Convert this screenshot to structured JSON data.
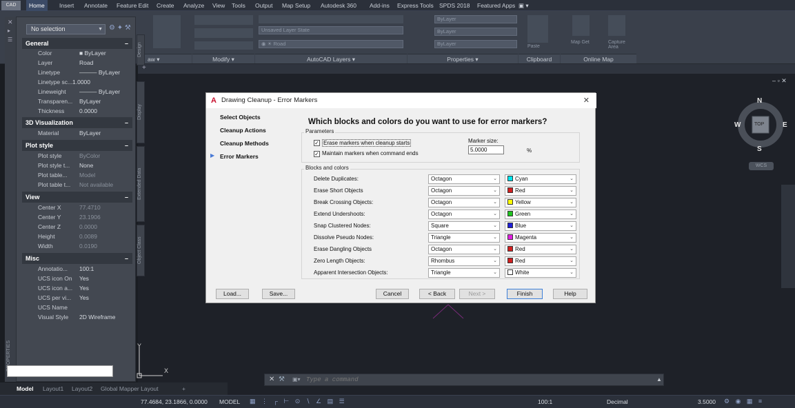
{
  "ribbon": {
    "app_button": "CAD",
    "tabs": [
      "Home",
      "Insert",
      "Annotate",
      "Feature Edit",
      "Create",
      "Analyze",
      "View",
      "Tools",
      "Output",
      "Map Setup",
      "Autodesk 360",
      "Add-ins",
      "Express Tools",
      "SPDS 2018",
      "Featured Apps"
    ],
    "active_tab": "Home",
    "panels": {
      "draw": "aw",
      "modify": "Modify",
      "layers": "AutoCAD Layers",
      "properties": "Properties",
      "clipboard": "Clipboard",
      "online_map": "Online Map"
    },
    "layer_state": "Unsaved Layer State",
    "layer_current": "Road",
    "bylayer_1": "ByLayer",
    "bylayer_2": "ByLayer",
    "bylayer_3": "ByLayer",
    "paste": "Paste",
    "map_get": "Map Get",
    "capture_area": "Capture Area"
  },
  "properties_palette": {
    "selection": "No selection",
    "side_title": "PROPERTIES",
    "vertical_tabs": [
      "Design",
      "Display",
      "Extended Data",
      "Object Class"
    ],
    "categories": {
      "general": "General",
      "viz3d": "3D Visualization",
      "plot": "Plot style",
      "view": "View",
      "misc": "Misc"
    },
    "general_rows": [
      {
        "k": "Color",
        "v": "■ ByLayer"
      },
      {
        "k": "Layer",
        "v": "Road"
      },
      {
        "k": "Linetype",
        "v": "——— ByLayer"
      },
      {
        "k": "Linetype sc...",
        "v": "1.0000"
      },
      {
        "k": "Lineweight",
        "v": "——— ByLayer"
      },
      {
        "k": "Transparen...",
        "v": "ByLayer"
      },
      {
        "k": "Thickness",
        "v": "0.0000"
      }
    ],
    "viz3d_rows": [
      {
        "k": "Material",
        "v": "ByLayer"
      }
    ],
    "plot_rows": [
      {
        "k": "Plot style",
        "v": "ByColor"
      },
      {
        "k": "Plot style t...",
        "v": "None"
      },
      {
        "k": "Plot table...",
        "v": "Model"
      },
      {
        "k": "Plot table t...",
        "v": "Not available"
      }
    ],
    "view_rows": [
      {
        "k": "Center X",
        "v": "77.4710"
      },
      {
        "k": "Center Y",
        "v": "23.1906"
      },
      {
        "k": "Center Z",
        "v": "0.0000"
      },
      {
        "k": "Height",
        "v": "0.0089"
      },
      {
        "k": "Width",
        "v": "0.0190"
      }
    ],
    "misc_rows": [
      {
        "k": "Annotatio...",
        "v": "100:1"
      },
      {
        "k": "UCS icon On",
        "v": "Yes"
      },
      {
        "k": "UCS icon a...",
        "v": "Yes"
      },
      {
        "k": "UCS per vi...",
        "v": "Yes"
      },
      {
        "k": "UCS Name",
        "v": ""
      },
      {
        "k": "Visual Style",
        "v": "2D Wireframe"
      }
    ]
  },
  "dialog": {
    "title": "Drawing Cleanup - Error Markers",
    "nav": [
      "Select Objects",
      "Cleanup Actions",
      "Cleanup Methods",
      "Error Markers"
    ],
    "heading": "Which blocks and colors do you want to use for error markers?",
    "parameters_label": "Parameters",
    "erase_markers": "Erase markers when cleanup starts",
    "maintain_markers": "Maintain markers when command ends",
    "marker_size_label": "Marker size:",
    "marker_size_value": "5.0000",
    "marker_size_unit": "%",
    "blocks_label": "Blocks and colors",
    "rows": [
      {
        "label": "Delete Duplicates:",
        "block": "Octagon",
        "color": "Cyan",
        "hex": "#00e5ee"
      },
      {
        "label": "Erase Short Objects",
        "block": "Octagon",
        "color": "Red",
        "hex": "#d21f1f"
      },
      {
        "label": "Break Crossing Objects:",
        "block": "Octagon",
        "color": "Yellow",
        "hex": "#ffff00"
      },
      {
        "label": "Extend Undershoots:",
        "block": "Octagon",
        "color": "Green",
        "hex": "#1fc41f"
      },
      {
        "label": "Snap Clustered Nodes:",
        "block": "Square",
        "color": "Blue",
        "hex": "#1f1fd8"
      },
      {
        "label": "Dissolve Pseudo Nodes:",
        "block": "Triangle",
        "color": "Magenta",
        "hex": "#e21fe2"
      },
      {
        "label": "Erase Dangling Objects",
        "block": "Octagon",
        "color": "Red",
        "hex": "#d21f1f"
      },
      {
        "label": "Zero Length Objects:",
        "block": "Rhombus",
        "color": "Red",
        "hex": "#d21f1f"
      },
      {
        "label": "Apparent Intersection Objects:",
        "block": "Triangle",
        "color": "White",
        "hex": "#ffffff"
      }
    ],
    "buttons": {
      "load": "Load...",
      "save": "Save...",
      "cancel": "Cancel",
      "back": "< Back",
      "next": "Next >",
      "finish": "Finish",
      "help": "Help"
    }
  },
  "viewcube": {
    "n": "N",
    "s": "S",
    "e": "E",
    "w": "W",
    "top": "TOP",
    "wcs": "WCS"
  },
  "command_line": {
    "placeholder": "Type a command"
  },
  "layout_tabs": [
    "Model",
    "Layout1",
    "Layout2",
    "Global Mapper Layout"
  ],
  "status": {
    "coords": "77.4684, 23.1866, 0.0000",
    "model": "MODEL",
    "scale": "100:1",
    "units": "Decimal",
    "value": "3.5000"
  }
}
